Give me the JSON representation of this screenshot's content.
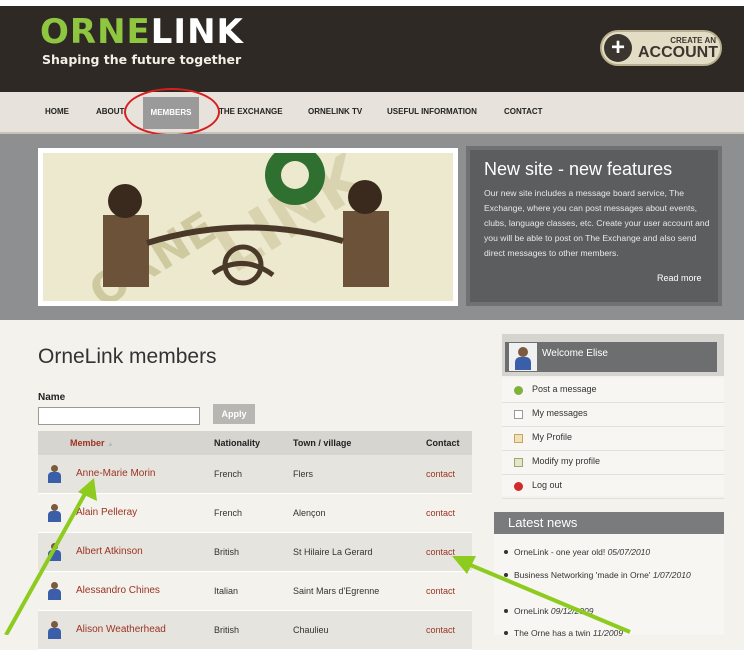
{
  "header": {
    "logo_part1": "ORNE",
    "logo_part2": "LINK",
    "tagline": "Shaping the future together",
    "create_line1": "CREATE AN",
    "create_line2": "ACCOUNT"
  },
  "nav": [
    {
      "label": "HOME"
    },
    {
      "label": "ABOUT"
    },
    {
      "label": "MEMBERS"
    },
    {
      "label": "THE EXCHANGE"
    },
    {
      "label": "ORNELINK TV"
    },
    {
      "label": "USEFUL INFORMATION"
    },
    {
      "label": "CONTACT"
    }
  ],
  "banner": {
    "image_text_1": "ORNE",
    "image_text_2": "LINK",
    "title": "New site - new features",
    "body": "Our new site includes a message board service, The Exchange, where you can post messages about events, clubs, language classes, etc. Create your user account and you will be able to post on The Exchange and also send direct messages to other members.",
    "read_more": "Read more"
  },
  "members": {
    "title": "OrneLink members",
    "filter_label": "Name",
    "filter_value": "",
    "apply_label": "Apply",
    "columns": [
      "Member",
      "Nationality",
      "Town / village",
      "Contact"
    ],
    "sort_indicator": "▲",
    "rows": [
      {
        "name": "Anne-Marie Morin",
        "nationality": "French",
        "town": "Flers",
        "contact": "contact"
      },
      {
        "name": "Alain Pelleray",
        "nationality": "French",
        "town": "Alençon",
        "contact": "contact"
      },
      {
        "name": "Albert Atkinson",
        "nationality": "British",
        "town": "St Hilaire La Gerard",
        "contact": "contact"
      },
      {
        "name": "Alessandro Chines",
        "nationality": "Italian",
        "town": "Saint Mars d'Egrenne",
        "contact": "contact"
      },
      {
        "name": "Alison Weatherhead",
        "nationality": "British",
        "town": "Chaulieu",
        "contact": "contact"
      }
    ]
  },
  "sidebar": {
    "welcome": "Welcome Elise",
    "items": [
      {
        "label": "Post a message",
        "icon": "plus-circle-icon",
        "color": "#7fb23a"
      },
      {
        "label": "My messages",
        "icon": "document-icon",
        "color": "#9a9a9a"
      },
      {
        "label": "My Profile",
        "icon": "profile-icon",
        "color": "#c9a45a"
      },
      {
        "label": "Modify my profile",
        "icon": "edit-profile-icon",
        "color": "#9aa86a"
      },
      {
        "label": "Log out",
        "icon": "logout-icon",
        "color": "#d02a2a"
      }
    ],
    "latest_title": "Latest news",
    "news": [
      {
        "text": "OrneLink - one year old!",
        "date": "05/07/2010"
      },
      {
        "text": "Business Networking 'made in Orne'",
        "date": "1/07/2010"
      },
      {
        "text": "OrneLink",
        "date": "09/12/2009"
      },
      {
        "text": "The Orne has a twin",
        "date": "11/2009"
      }
    ]
  },
  "colors": {
    "logo_green": "#8fc63f",
    "link_red": "#9b3322",
    "annotation_green": "#8ecb1f",
    "annotation_red": "#d81f1f"
  }
}
